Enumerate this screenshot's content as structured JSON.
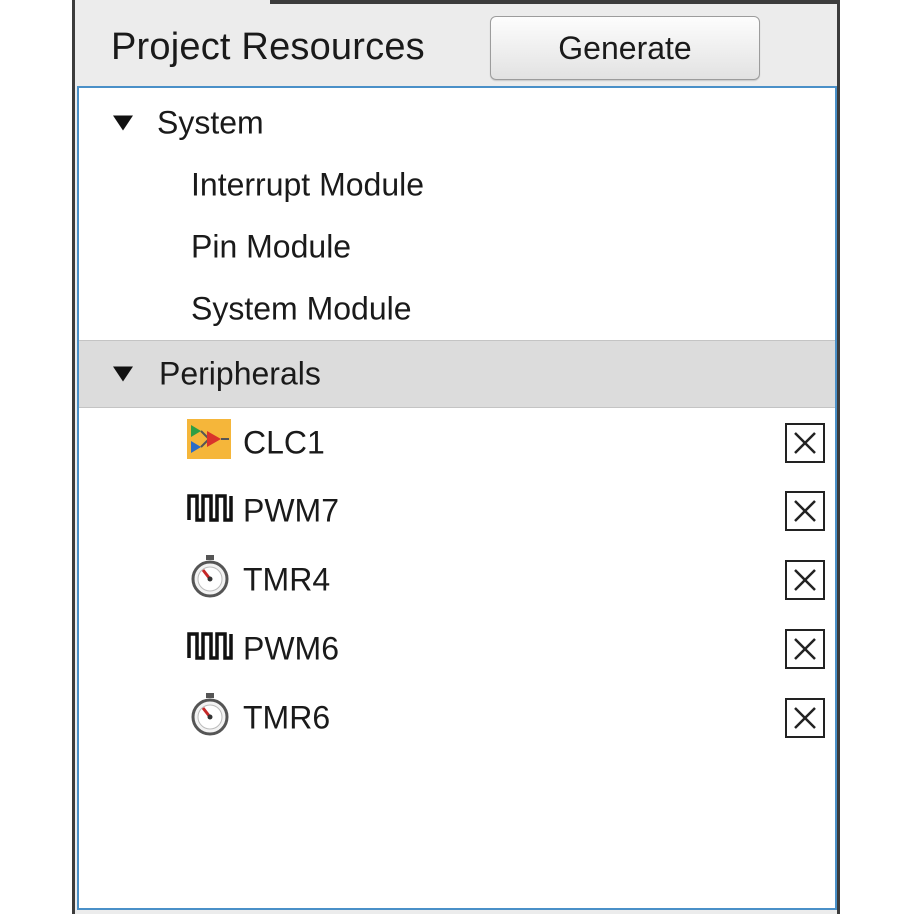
{
  "header": {
    "title": "Project Resources",
    "generate_label": "Generate"
  },
  "tree": {
    "system": {
      "label": "System",
      "expanded": true,
      "children": [
        "Interrupt Module",
        "Pin Module",
        "System Module"
      ]
    },
    "peripherals": {
      "label": "Peripherals",
      "expanded": true,
      "selected": true,
      "children": [
        {
          "label": "CLC1",
          "icon": "clc-icon"
        },
        {
          "label": "PWM7",
          "icon": "pwm-icon"
        },
        {
          "label": "TMR4",
          "icon": "timer-icon"
        },
        {
          "label": "PWM6",
          "icon": "pwm-icon"
        },
        {
          "label": "TMR6",
          "icon": "timer-icon"
        }
      ]
    }
  },
  "colors": {
    "tree_border": "#4a90c8",
    "selected_row": "#dcdcdc",
    "panel_bg": "#ececec"
  }
}
